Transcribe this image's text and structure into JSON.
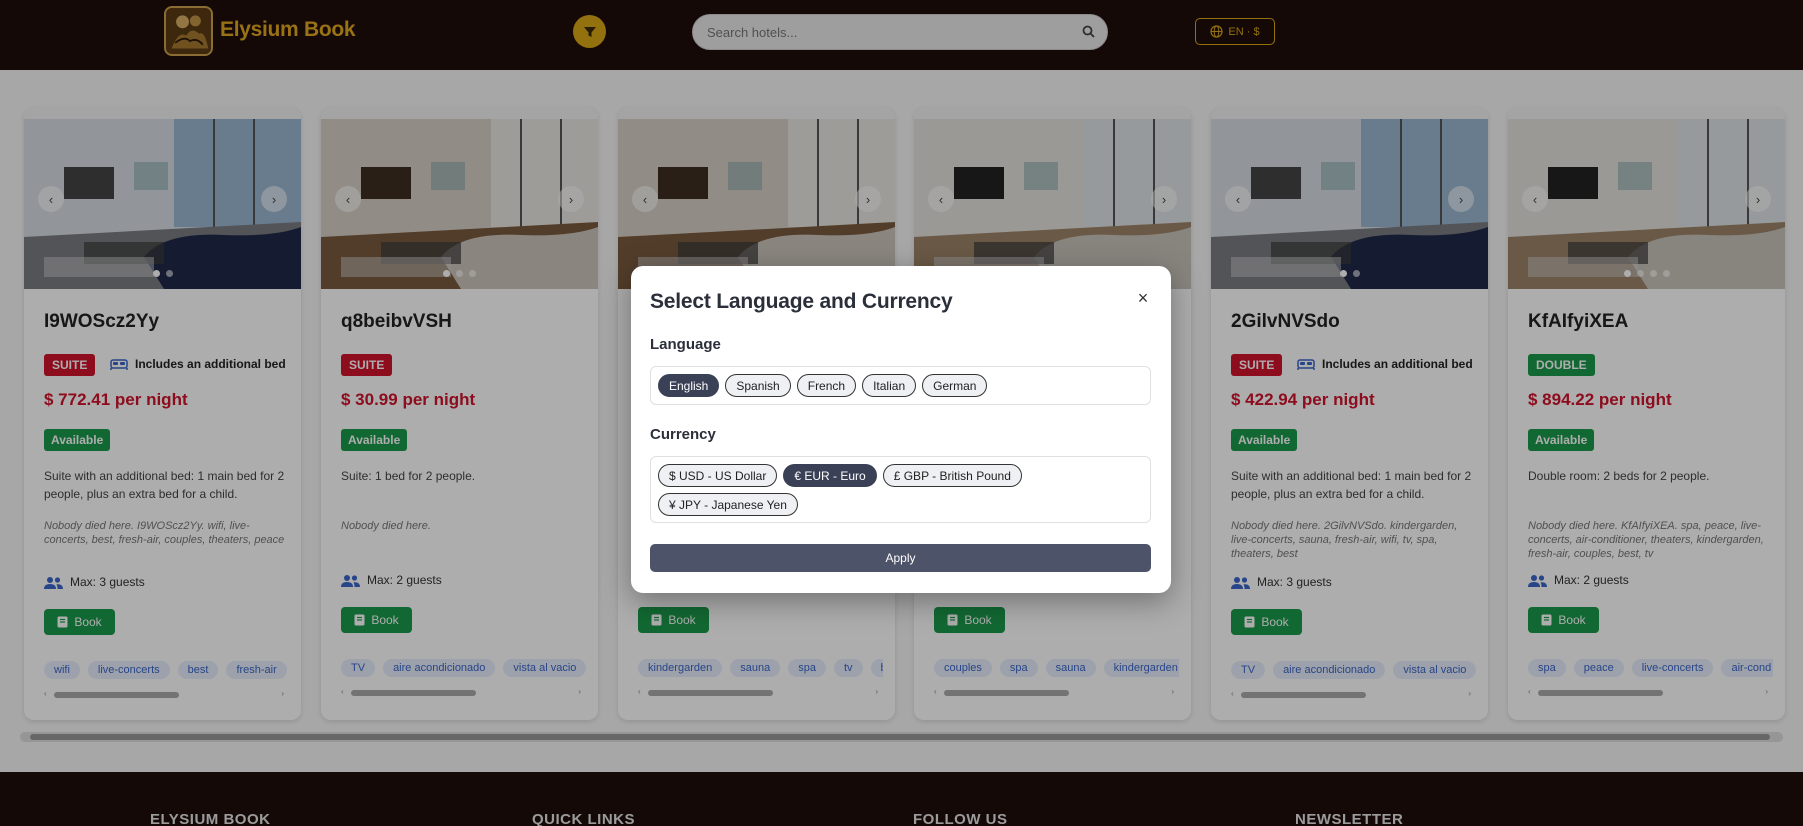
{
  "header": {
    "brand": "Elysium Book",
    "search_placeholder": "Search hotels...",
    "lang_button": "EN · $"
  },
  "cards": [
    {
      "title": "I9WOScz2Yy",
      "type": "SUITE",
      "extra": "Includes an additional bed",
      "price": "$ 772.41 per night",
      "status": "Available",
      "desc": "Suite with an additional bed: 1 main bed for 2 people, plus an extra bed for a child.",
      "note": "Nobody died here. I9WOScz2Yy. wifi, live-concerts, best, fresh-air, couples, theaters, peace",
      "guests": "Max: 3 guests",
      "book": "Book",
      "tags": [
        "wifi",
        "live-concerts",
        "best",
        "fresh-air"
      ]
    },
    {
      "title": "q8beibvVSH",
      "type": "SUITE",
      "extra": "",
      "price": "$ 30.99 per night",
      "status": "Available",
      "desc": "Suite: 1 bed for 2 people.",
      "note": "Nobody died here.",
      "guests": "Max: 2 guests",
      "book": "Book",
      "tags": [
        "TV",
        "aire acondicionado",
        "vista al vacio"
      ]
    },
    {
      "title": "",
      "type": "",
      "extra": "",
      "price": "",
      "status": "",
      "desc": "",
      "note": "",
      "guests": "",
      "book": "Book",
      "tags": [
        "kindergarden",
        "sauna",
        "spa",
        "tv",
        "b"
      ]
    },
    {
      "title": "",
      "type": "",
      "extra": "",
      "price": "",
      "status": "",
      "desc": "",
      "note": "",
      "guests": "",
      "book": "Book",
      "tags": [
        "couples",
        "spa",
        "sauna",
        "kindergarden"
      ]
    },
    {
      "title": "2GilvNVSdo",
      "type": "SUITE",
      "extra": "Includes an additional bed",
      "price": "$ 422.94 per night",
      "status": "Available",
      "desc": "Suite with an additional bed: 1 main bed for 2 people, plus an extra bed for a child.",
      "note": "Nobody died here. 2GilvNVSdo. kindergarden, live-concerts, sauna, fresh-air, wifi, tv, spa, theaters, best",
      "guests": "Max: 3 guests",
      "book": "Book",
      "tags": [
        "TV",
        "aire acondicionado",
        "vista al vacio"
      ]
    },
    {
      "title": "KfAIfyiXEA",
      "type": "DOUBLE",
      "extra": "",
      "price": "$ 894.22 per night",
      "status": "Available",
      "desc": "Double room: 2 beds for 2 people.",
      "note": "Nobody died here. KfAIfyiXEA. spa, peace, live-concerts, air-conditioner, theaters, kindergarden, fresh-air, couples, best, tv",
      "guests": "Max: 2 guests",
      "book": "Book",
      "tags": [
        "spa",
        "peace",
        "live-concerts",
        "air-cond"
      ]
    }
  ],
  "footer": {
    "col1": "ELYSIUM BOOK",
    "col2": "QUICK LINKS",
    "col3": "FOLLOW US",
    "col4": "NEWSLETTER"
  },
  "modal": {
    "title": "Select Language and Currency",
    "close": "×",
    "language_label": "Language",
    "languages": [
      "English",
      "Spanish",
      "French",
      "Italian",
      "German"
    ],
    "selected_language": "English",
    "currency_label": "Currency",
    "currencies": [
      "$ USD - US Dollar",
      "€ EUR - Euro",
      "£ GBP - British Pound",
      "¥ JPY - Japanese Yen"
    ],
    "selected_currency": "€ EUR - Euro",
    "apply": "Apply"
  },
  "colors": {
    "header_bg": "#1e0e09",
    "brand": "#e0a81e",
    "suite_badge": "#d0122b",
    "available_badge": "#1b9a4b",
    "price": "#d0122b",
    "selected_pill": "#3a4055",
    "apply_button": "#4d5368"
  },
  "icons": {
    "filter": "funnel-icon",
    "search": "magnifier-icon",
    "language": "globe-icon",
    "bed": "bed-icon",
    "guests": "people-icon",
    "book": "book-icon"
  }
}
